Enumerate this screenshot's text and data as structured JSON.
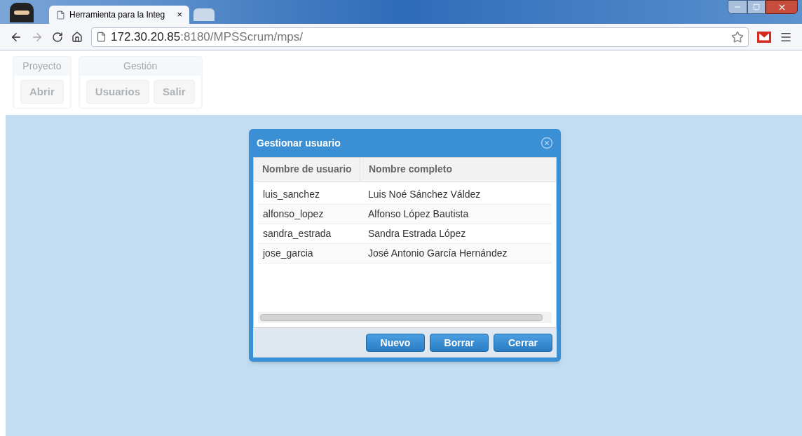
{
  "browser": {
    "tab_title": "Herramienta para la Integ",
    "tab_close": "×",
    "address_host": "172.30.20.85",
    "address_path": ":8180/MPSScrum/mps/"
  },
  "toolbar_groups": [
    {
      "title": "Proyecto",
      "buttons": [
        {
          "label": "Abrir",
          "disabled": true
        }
      ]
    },
    {
      "title": "Gestión",
      "buttons": [
        {
          "label": "Usuarios",
          "disabled": true
        },
        {
          "label": "Salir",
          "disabled": true
        }
      ]
    }
  ],
  "dialog": {
    "title": "Gestionar usuario",
    "columns": [
      "Nombre de usuario",
      "Nombre completo"
    ],
    "rows": [
      [
        "luis_sanchez",
        "Luis Noé Sánchez Váldez"
      ],
      [
        "alfonso_lopez",
        "Alfonso López Bautista"
      ],
      [
        "sandra_estrada",
        "Sandra Estrada López"
      ],
      [
        "jose_garcia",
        "José Antonio García Hernández"
      ]
    ],
    "buttons": [
      "Nuevo",
      "Borrar",
      "Cerrar"
    ]
  }
}
